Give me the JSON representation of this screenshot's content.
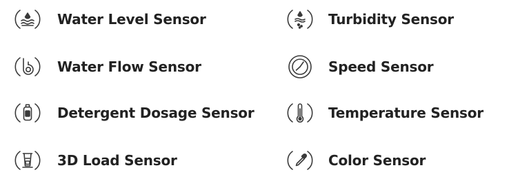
{
  "colors": {
    "icon_stroke": "#3a3a3a",
    "text": "#222222",
    "background": "#ffffff"
  },
  "sensors": [
    {
      "label": "Water Level Sensor",
      "icon": "water-level-icon"
    },
    {
      "label": "Turbidity Sensor",
      "icon": "turbidity-icon"
    },
    {
      "label": "Water Flow Sensor",
      "icon": "water-flow-icon"
    },
    {
      "label": "Speed Sensor",
      "icon": "speed-icon"
    },
    {
      "label": "Detergent Dosage Sensor",
      "icon": "detergent-bottle-icon"
    },
    {
      "label": "Temperature Sensor",
      "icon": "thermometer-icon"
    },
    {
      "label": "3D Load Sensor",
      "icon": "load-icon"
    },
    {
      "label": "Color Sensor",
      "icon": "dropper-icon"
    }
  ]
}
